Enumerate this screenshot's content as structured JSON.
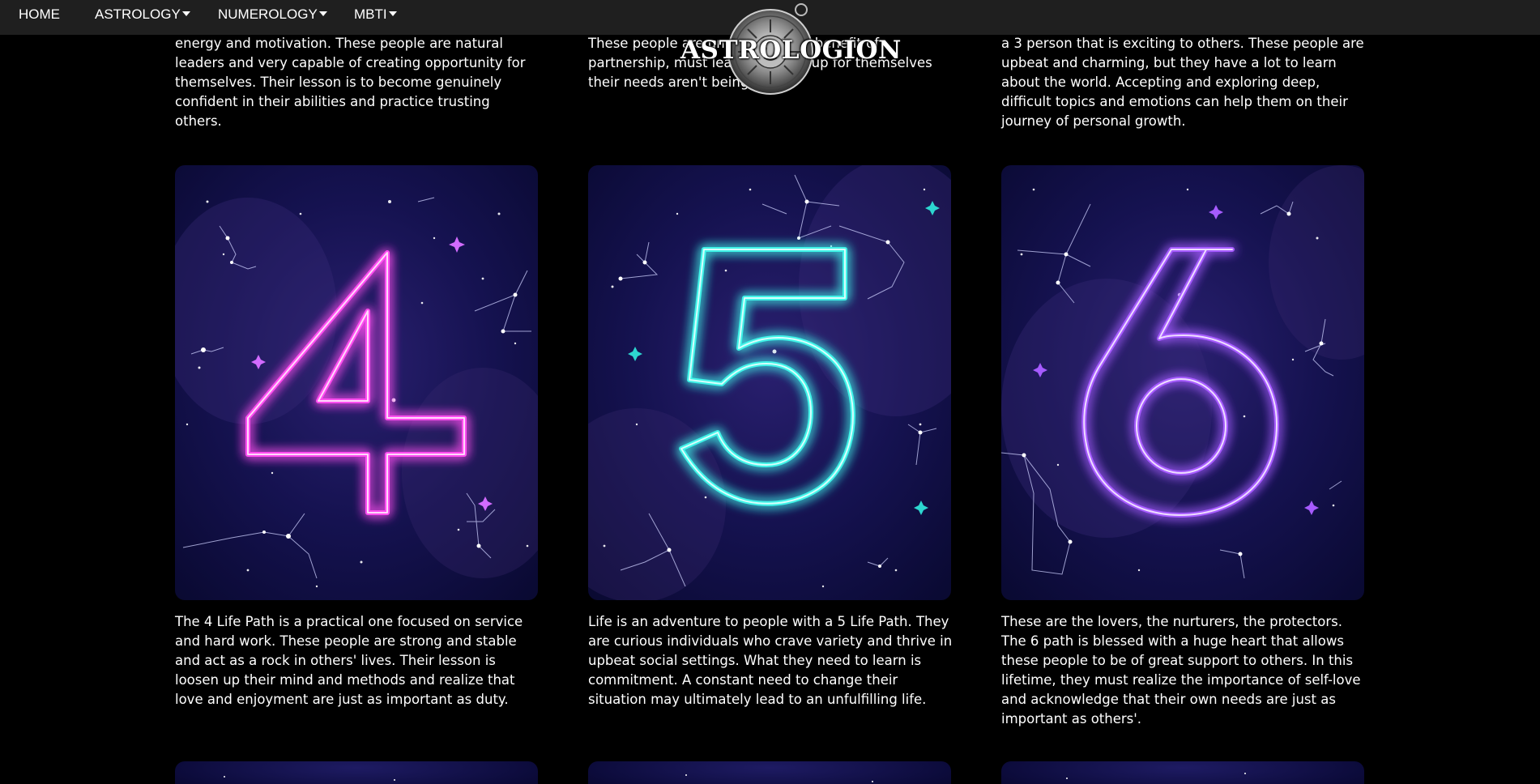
{
  "nav": {
    "home": "HOME",
    "astrology": "ASTROLOGY",
    "numerology": "NUMEROLOGY",
    "mbti": "MBTI"
  },
  "logo": {
    "text": "ASTROLOGION"
  },
  "top_texts": [
    "energy and motivation. These people are natural leaders and very capable of creating opportunity for themselves. Their lesson is to become genuinely confident in their abilities and practice trusting others.",
    "These people are               understand the benefit of partnership,           must learn to speak up for themselves       their needs aren't being met.",
    "a 3 person that is exciting to others. These people are upbeat and charming, but they have a lot to learn about the world. Accepting and exploring deep, difficult topics and emotions can help them on their journey of personal growth."
  ],
  "cards": [
    {
      "number": "4",
      "color": "#ff4df0",
      "glow": "#ff2bd6"
    },
    {
      "number": "5",
      "color": "#3ff3e8",
      "glow": "#18d9d2"
    },
    {
      "number": "6",
      "color": "#a65bff",
      "glow": "#8a3bff"
    }
  ],
  "descriptions": [
    "The 4 Life Path is a practical one focused on service and hard work. These people are strong and stable and act as a rock in others' lives. Their lesson is loosen up their mind and methods and realize that love and enjoyment are just as important as duty.",
    "Life is an adventure to people with a 5 Life Path. They are curious individuals who crave variety and thrive in upbeat social settings. What they need to learn is commitment. A constant need to change their situation may ultimately lead to an unfulfilling life.",
    "These are the lovers, the nurturers, the protectors. The 6 path is blessed with a huge heart that allows these people to be of great support to others. In this lifetime, they must realize the importance of self-love and acknowledge that their own needs are just as important as others'."
  ],
  "colors": {
    "nav_bg": "#1f1f1f",
    "page_bg": "#000000",
    "card_bg": "#0f0d45"
  }
}
